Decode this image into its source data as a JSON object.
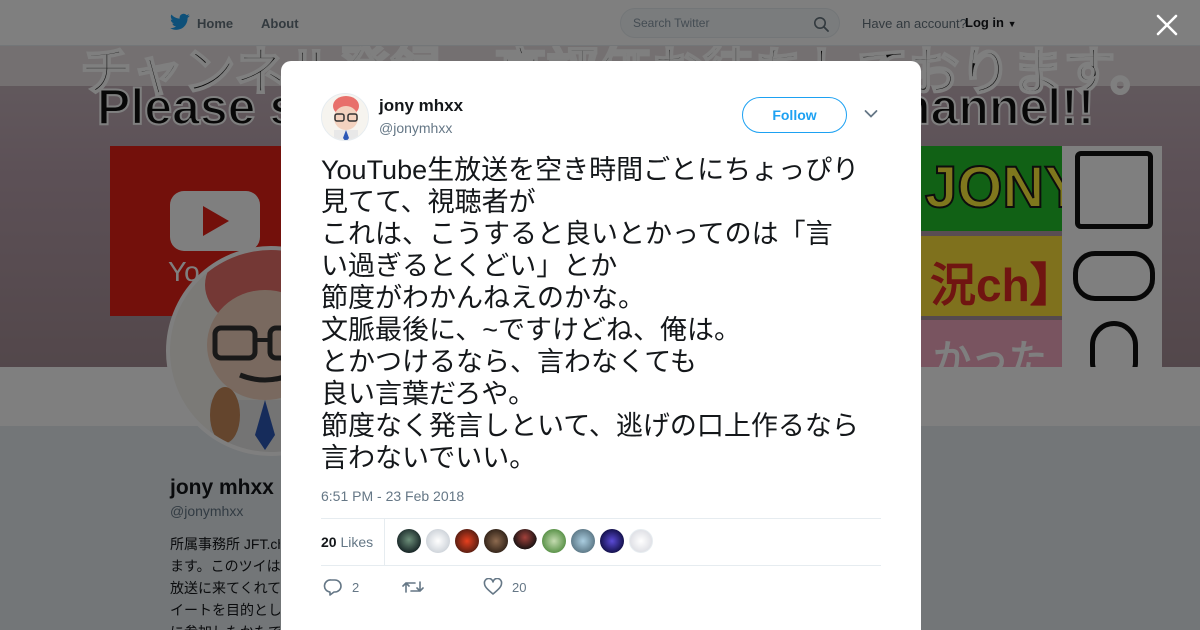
{
  "nav": {
    "home": "Home",
    "about": "About",
    "search_placeholder": "Search Twitter",
    "have_account": "Have an account?",
    "login": "Log in"
  },
  "profile": {
    "name": "jony mhxx",
    "handle": "@jonymhxx",
    "bio_lines": [
      "所属事務所 JFT.ch",
      "ます。このツイは",
      "放送に来てくれて",
      "イートを目的とし",
      "に参加したかたで"
    ]
  },
  "banner": {
    "line1": "チャンネル登録、高評価お待ちしております。",
    "line2": "Please su",
    "line3": "hannel!!",
    "youtube_word": "Yo",
    "jony_word": "JONY",
    "ch_word": "況ch】",
    "pink_word": "かった"
  },
  "tweet": {
    "name": "jony mhxx",
    "handle": "@jonymhxx",
    "follow_label": "Follow",
    "lines": [
      "YouTube生放送を空き時間ごとにちょっぴり",
      "見てて、視聴者が",
      "これは、こうすると良いとかってのは「言",
      "い過ぎるとくどい」とか",
      "節度がわかんねえのかな。",
      "文脈最後に、~ですけどね、俺は。",
      "とかつけるなら、言わなくても",
      "良い言葉だろや。",
      "節度なく発言しといて、逃げの口上作るなら",
      "言わないでいい。"
    ],
    "timestamp": "6:51 PM - 23 Feb 2018",
    "likes_count": "20",
    "likes_label": "Likes",
    "reply_count": "2",
    "like_action_count": "20"
  },
  "colors": {
    "twitter_blue": "#1da1f2",
    "overlay": "rgba(0,0,0,0.5)"
  }
}
